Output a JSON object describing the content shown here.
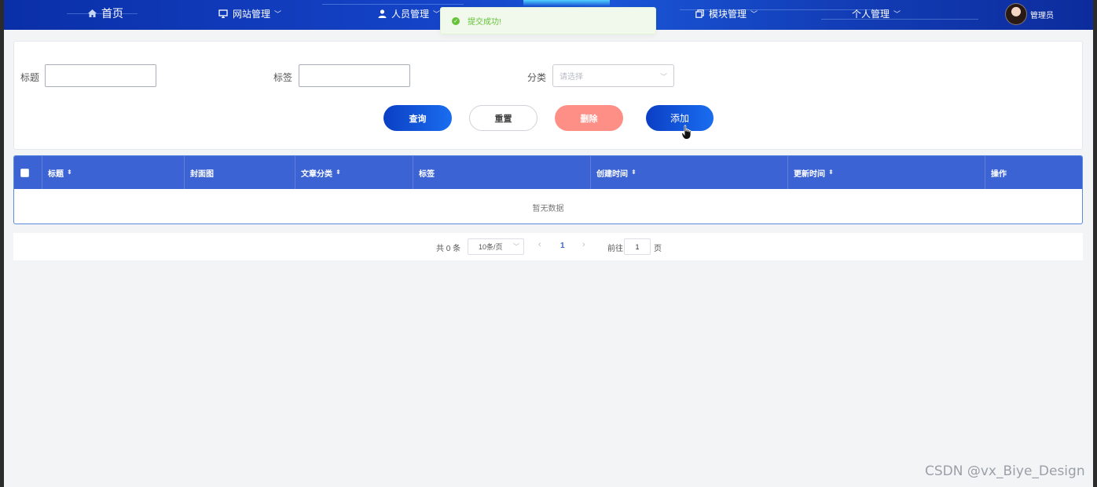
{
  "nav": {
    "home": "首页",
    "site_mgmt": "网站管理",
    "staff_mgmt": "人员管理",
    "module_mgmt": "模块管理",
    "personal_mgmt": "个人管理",
    "admin_name": "管理员"
  },
  "toast": {
    "message": "提交成功!"
  },
  "search": {
    "title_label": "标题",
    "tag_label": "标签",
    "category_label": "分类",
    "category_placeholder": "请选择"
  },
  "buttons": {
    "query": "查询",
    "reset": "重置",
    "delete": "删除",
    "add": "添加"
  },
  "table": {
    "columns": [
      "标题",
      "封面图",
      "文章分类",
      "标签",
      "创建时间",
      "更新时间",
      "操作"
    ],
    "empty_text": "暂无数据"
  },
  "pagination": {
    "total": "共 0 条",
    "page_size": "10条/页",
    "current_page": "1",
    "goto_label": "前往",
    "goto_value": "1",
    "page_suffix": "页"
  },
  "watermark": "CSDN @vx_Biye_Design",
  "colors": {
    "nav_bg": "#1544c8",
    "table_header": "#3c63d4",
    "primary": "#1a6df0",
    "danger_light": "#fe8f86",
    "success": "#67c23a"
  }
}
